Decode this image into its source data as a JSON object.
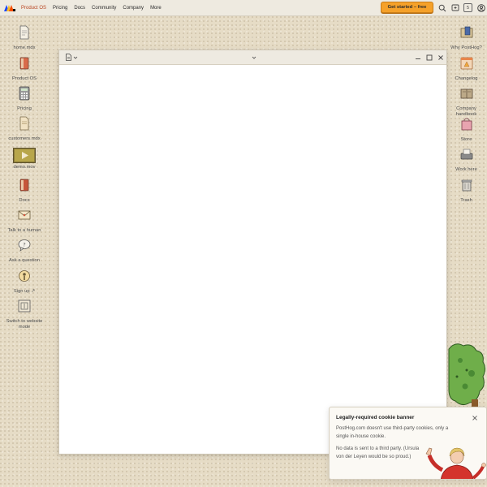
{
  "topbar": {
    "nav": [
      "Product OS",
      "Pricing",
      "Docs",
      "Community",
      "Company",
      "More"
    ],
    "cta_label": "Get started – free",
    "badge_count": "5",
    "icons": [
      "search-icon",
      "chat-icon",
      "badge-icon",
      "user-icon"
    ]
  },
  "desktop_left": [
    {
      "label": "home.mdx",
      "icon": "document-icon"
    },
    {
      "label": "Product OS",
      "icon": "book-icon"
    },
    {
      "label": "Pricing",
      "icon": "calculator-icon"
    },
    {
      "label": "customers.mdx",
      "icon": "document-icon"
    },
    {
      "label": "demo.mov",
      "icon": "video-icon"
    },
    {
      "label": "Docs",
      "icon": "book-icon"
    },
    {
      "label": "Talk to a human",
      "icon": "envelope-icon"
    },
    {
      "label": "Ask a question",
      "icon": "question-icon"
    },
    {
      "label": "Sign up ↗",
      "icon": "signup-icon"
    },
    {
      "label": "Switch to website mode",
      "icon": "switch-icon"
    }
  ],
  "desktop_right": [
    {
      "label": "Why PostHog?",
      "icon": "folder-icon"
    },
    {
      "label": "Changelog",
      "icon": "changelog-icon"
    },
    {
      "label": "Company handbook",
      "icon": "handbook-icon"
    },
    {
      "label": "Store",
      "icon": "bag-icon"
    },
    {
      "label": "Work here",
      "icon": "typewriter-icon"
    },
    {
      "label": "Trash",
      "icon": "trash-icon"
    }
  ],
  "cookie": {
    "title": "Legally-required cookie banner",
    "p1": "PostHog.com doesn't use third-party cookies, only a single in-house cookie.",
    "p2": "No data is sent to a third party. (Ursula von der Leyen would be so proud.)"
  },
  "colors": {
    "accent": "#f5a12a",
    "nav_active": "#b8431f"
  }
}
